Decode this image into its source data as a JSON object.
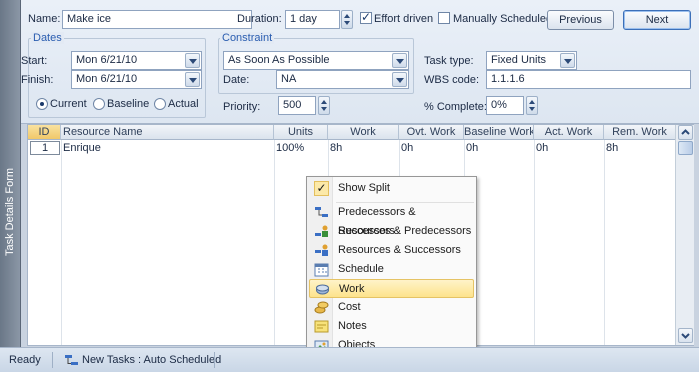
{
  "side_tab": {
    "label": "Task Details Form"
  },
  "form": {
    "name_label": "Name:",
    "name_value": "Make ice",
    "duration_label": "Duration:",
    "duration_value": "1 day",
    "effort_driven_label": "Effort driven",
    "effort_driven_checked": true,
    "manually_scheduled_label": "Manually Scheduled",
    "manually_scheduled_checked": false,
    "previous_label": "Previous",
    "next_label": "Next",
    "dates": {
      "title": "Dates",
      "start_label": "Start:",
      "start_value": "Mon 6/21/10",
      "finish_label": "Finish:",
      "finish_value": "Mon 6/21/10",
      "views": [
        "Current",
        "Baseline",
        "Actual"
      ],
      "selected_view": "Current"
    },
    "constraint": {
      "title": "Constraint",
      "type_value": "As Soon As Possible",
      "date_label": "Date:",
      "date_value": "NA"
    },
    "priority_label": "Priority:",
    "priority_value": "500",
    "task_type_label": "Task type:",
    "task_type_value": "Fixed Units",
    "wbs_label": "WBS code:",
    "wbs_value": "1.1.1.6",
    "complete_label": "% Complete:",
    "complete_value": "0%"
  },
  "grid": {
    "columns": [
      "ID",
      "Resource Name",
      "Units",
      "Work",
      "Ovt. Work",
      "Baseline Work",
      "Act. Work",
      "Rem. Work"
    ],
    "rows": [
      {
        "id": "1",
        "resource_name": "Enrique",
        "units": "100%",
        "work": "8h",
        "ovt_work": "0h",
        "baseline_work": "0h",
        "act_work": "0h",
        "rem_work": "8h"
      }
    ]
  },
  "context_menu": {
    "items": [
      {
        "label": "Show Split",
        "icon": "check-icon",
        "checked": true
      },
      {
        "label": "Predecessors & Successors",
        "icon": "predecessors-successors-icon"
      },
      {
        "label": "Resources & Predecessors",
        "icon": "resources-predecessors-icon"
      },
      {
        "label": "Resources & Successors",
        "icon": "resources-successors-icon"
      },
      {
        "label": "Schedule",
        "icon": "calendar-icon"
      },
      {
        "label": "Work",
        "icon": "work-icon",
        "highlighted": true
      },
      {
        "label": "Cost",
        "icon": "cost-icon"
      },
      {
        "label": "Notes",
        "icon": "notes-icon"
      },
      {
        "label": "Objects",
        "icon": "objects-icon"
      }
    ]
  },
  "status_bar": {
    "ready": "Ready",
    "new_tasks": "New Tasks : Auto Scheduled"
  },
  "colors": {
    "accent": "#2a5db0",
    "menu_highlight": "#fde38c",
    "id_header": "#f0c869"
  }
}
